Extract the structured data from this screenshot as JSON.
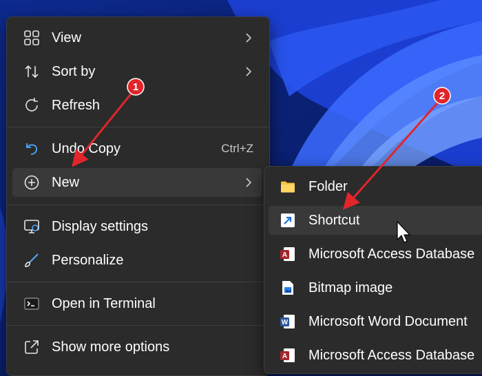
{
  "context_menu": {
    "items": [
      {
        "label": "View",
        "icon": "grid-icon"
      },
      {
        "label": "Sort by",
        "icon": "sort-arrows-icon"
      },
      {
        "label": "Refresh",
        "icon": "refresh-icon"
      },
      {
        "label": "Undo Copy",
        "icon": "undo-icon",
        "shortcut": "Ctrl+Z"
      },
      {
        "label": "New",
        "icon": "plus-circle-icon"
      },
      {
        "label": "Display settings",
        "icon": "display-icon"
      },
      {
        "label": "Personalize",
        "icon": "brush-icon"
      },
      {
        "label": "Open in Terminal",
        "icon": "terminal-icon"
      },
      {
        "label": "Show more options",
        "icon": "external-link-icon"
      }
    ]
  },
  "new_submenu": {
    "items": [
      {
        "label": "Folder",
        "icon": "folder-icon"
      },
      {
        "label": "Shortcut",
        "icon": "shortcut-icon"
      },
      {
        "label": "Microsoft Access Database",
        "icon": "access-icon"
      },
      {
        "label": "Bitmap image",
        "icon": "bitmap-icon"
      },
      {
        "label": "Microsoft Word Document",
        "icon": "word-icon"
      },
      {
        "label": "Microsoft Access Database",
        "icon": "access-icon"
      }
    ]
  },
  "annotations": {
    "step1": "1",
    "step2": "2"
  },
  "colors": {
    "menu_bg": "#2b2b2b",
    "highlight": "#393939",
    "annotation_red": "#e0262b",
    "wallpaper_blue": "#1f4fe0"
  }
}
